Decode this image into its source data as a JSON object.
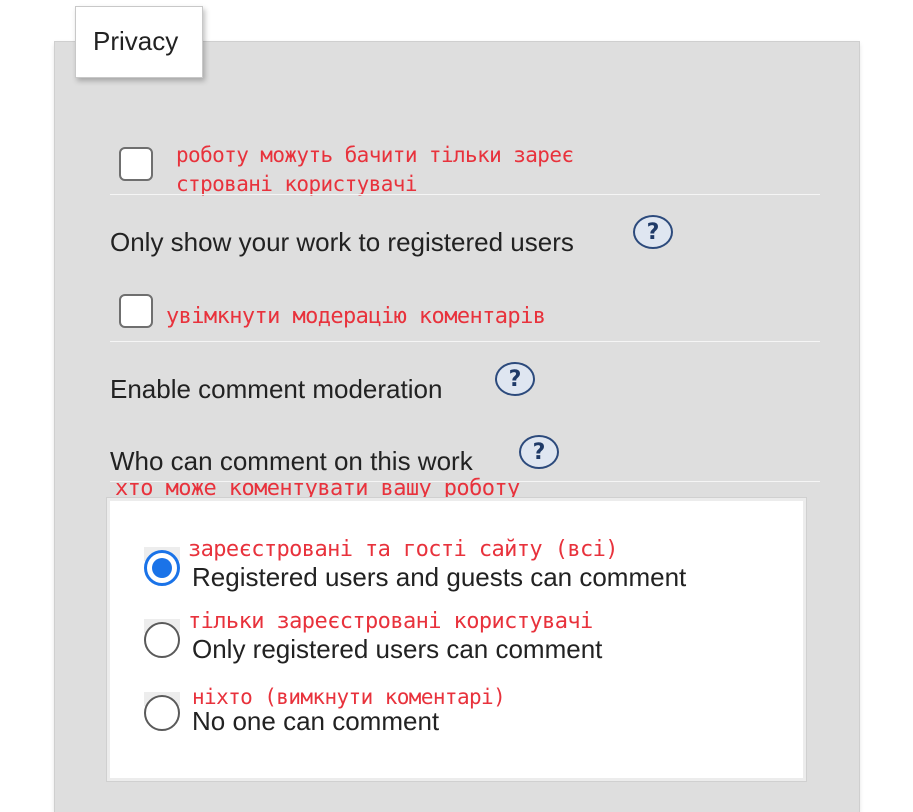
{
  "section": {
    "title": "Privacy"
  },
  "registered_only": {
    "checked": false,
    "annotation_line1": "роботу можуть бачити тільки зареє",
    "annotation_line2": "стровані користувачі",
    "label": "Only show your work to registered users",
    "help_icon": "question-mark-icon",
    "help_text": "?"
  },
  "moderation": {
    "checked": false,
    "annotation": "увімкнути модерацію коментарів",
    "label": "Enable comment moderation",
    "help_icon": "question-mark-icon",
    "help_text": "?"
  },
  "who_can_comment": {
    "label": "Who can comment on this work",
    "help_icon": "question-mark-icon",
    "help_text": "?",
    "annotation": "хто може коментувати вашу роботу",
    "selected_index": 0,
    "options": [
      {
        "annotation": "зареєстровані та гості сайту (всі)",
        "label": "Registered users and guests can comment"
      },
      {
        "annotation": "тільки зареєстровані користувачі",
        "label": "Only registered users can comment"
      },
      {
        "annotation": "ніхто (вимкнути коментарі)",
        "label": "No one can comment"
      }
    ]
  },
  "colors": {
    "annotation": "#e8323c",
    "radio_selected": "#1a73e8",
    "help_icon_border": "#2c4a7c",
    "panel_background": "#dedede"
  }
}
